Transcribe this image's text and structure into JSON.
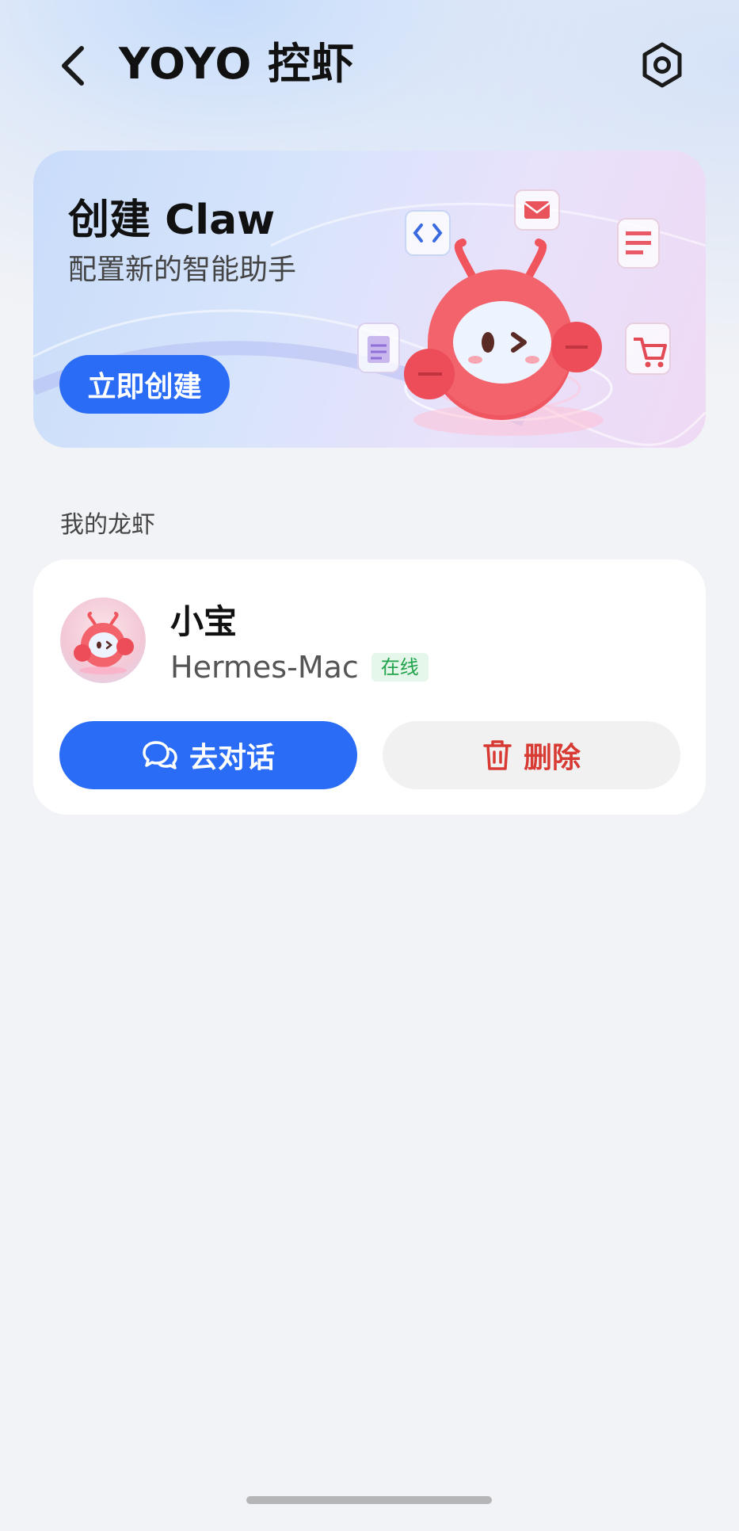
{
  "header": {
    "title": "YOYO 控虾"
  },
  "banner": {
    "title": "创建 Claw",
    "subtitle": "配置新的智能助手",
    "button_label": "立即创建"
  },
  "section": {
    "title": "我的龙虾"
  },
  "claw": {
    "name": "小宝",
    "device": "Hermes-Mac",
    "status": "在线",
    "chat_label": "去对话",
    "delete_label": "删除"
  },
  "colors": {
    "primary": "#2a6cf5",
    "danger": "#d83a34",
    "online": "#21a34a"
  },
  "icons": {
    "back": "chevron-left-icon",
    "settings": "settings-icon",
    "chat": "chat-bubbles-icon",
    "delete": "trash-icon"
  }
}
